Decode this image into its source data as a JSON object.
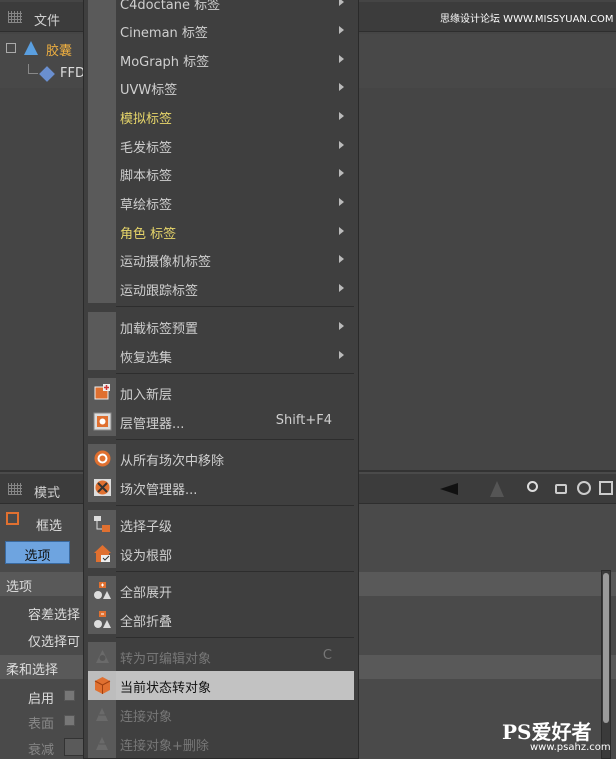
{
  "top_toolbar": {
    "file_label": "文件",
    "watermark_text": "思缘设计论坛 WWW.MISSYUAN.COM"
  },
  "object_tree": {
    "items": [
      {
        "label": "胶囊"
      },
      {
        "label": "FFD"
      }
    ]
  },
  "context_menu": {
    "items": [
      {
        "label": "C4doctane 标签",
        "has_submenu": true
      },
      {
        "label": "Cineman 标签",
        "has_submenu": true
      },
      {
        "label": "MoGraph 标签",
        "has_submenu": true
      },
      {
        "label": "UVW标签",
        "has_submenu": true
      },
      {
        "label": "模拟标签",
        "has_submenu": true
      },
      {
        "label": "毛发标签",
        "has_submenu": true
      },
      {
        "label": "脚本标签",
        "has_submenu": true
      },
      {
        "label": "草绘标签",
        "has_submenu": true
      },
      {
        "label": "角色 标签",
        "has_submenu": true
      },
      {
        "label": "运动摄像机标签",
        "has_submenu": true
      },
      {
        "label": "运动跟踪标签",
        "has_submenu": true
      },
      {
        "label": "加载标签预置",
        "has_submenu": true
      },
      {
        "label": "恢复选集",
        "has_submenu": true
      },
      {
        "label": "加入新层",
        "icon": "add-layer-icon"
      },
      {
        "label": "层管理器...",
        "shortcut": "Shift+F4",
        "icon": "layer-manager-icon"
      },
      {
        "label": "从所有场次中移除",
        "icon": "remove-take-icon"
      },
      {
        "label": "场次管理器...",
        "icon": "take-manager-icon"
      },
      {
        "label": "选择子级",
        "icon": "select-children-icon"
      },
      {
        "label": "设为根部",
        "icon": "set-root-icon"
      },
      {
        "label": "全部展开",
        "icon": "expand-all-icon"
      },
      {
        "label": "全部折叠",
        "icon": "collapse-all-icon"
      },
      {
        "label": "转为可编辑对象",
        "shortcut": "C",
        "icon": "make-editable-icon",
        "disabled": true
      },
      {
        "label": "当前状态转对象",
        "icon": "current-state-to-object-icon",
        "highlighted": true
      },
      {
        "label": "连接对象",
        "icon": "connect-objects-icon",
        "disabled": true
      },
      {
        "label": "连接对象+删除",
        "icon": "connect-delete-icon",
        "disabled": true
      }
    ]
  },
  "attribute_manager": {
    "mode_label": "模式",
    "tool_label": "框选",
    "tab_label": "选项",
    "section_options": "选项",
    "tolerance_label": "容差选择",
    "visible_only_label": "仅选择可",
    "section_soft": "柔和选择",
    "enable_label": "启用",
    "surface_label": "表面",
    "falloff_label": "衰减"
  },
  "watermark_bottom": {
    "brand": "PS爱好者",
    "url": "www.psahz.com"
  },
  "colors": {
    "highlight": "#c2c2c2",
    "yellow_text": "#e6d56a",
    "accent_blue": "#4a8fd8",
    "orange": "#e07030"
  }
}
